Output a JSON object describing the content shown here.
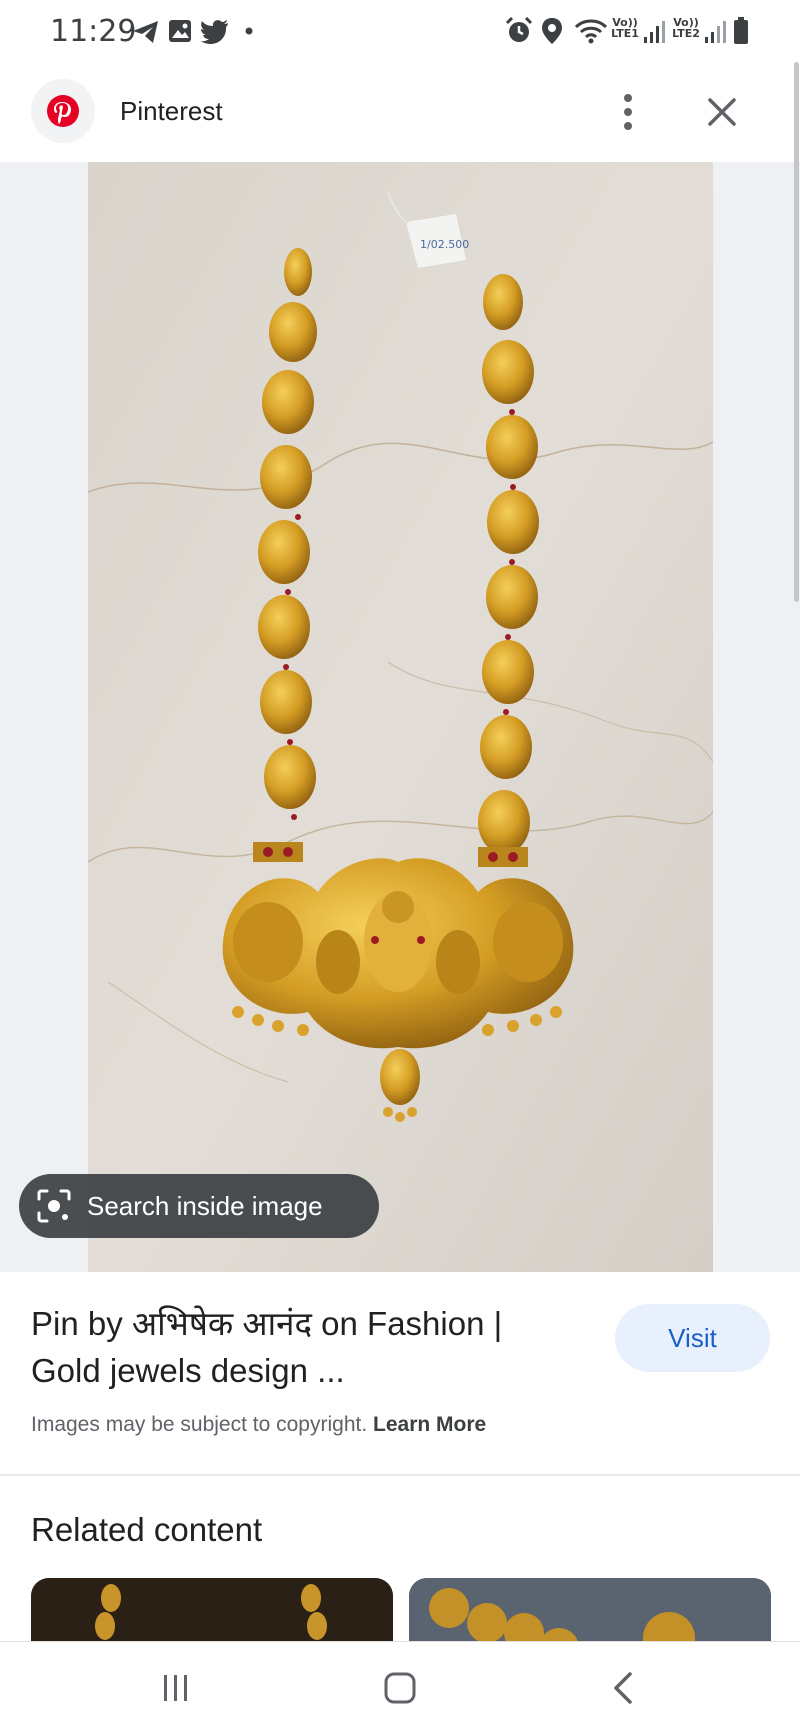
{
  "status_bar": {
    "time": "11:29",
    "left_icons": [
      "telegram-icon",
      "gallery-icon",
      "twitter-icon",
      "dot-icon"
    ],
    "right_icons": [
      "alarm-icon",
      "location-icon",
      "wifi-icon",
      "signal-icon",
      "battery-icon"
    ],
    "sim1_volte": "Vo))",
    "sim1_label": "LTE1",
    "sim2_volte": "Vo))",
    "sim2_label": "LTE2"
  },
  "header": {
    "site_name": "Pinterest",
    "logo_icon": "pinterest-logo",
    "more_icon": "more-vertical-icon",
    "close_icon": "close-icon",
    "brand_color": "#e60023"
  },
  "image": {
    "lens_button_label": "Search inside image",
    "tag_text": "1/02.500",
    "colors": {
      "gold": "#c9961e",
      "marble": "#d8d3cc",
      "backdrop": "#eef0f3"
    }
  },
  "result": {
    "title_line1": "Pin by अभिषेक आनंद on Fashion |",
    "title_line2": "Gold jewels design ...",
    "visit_label": "Visit",
    "copyright_text": "Images may be subject to copyright.",
    "learn_more_label": "Learn More"
  },
  "related": {
    "heading": "Related content"
  },
  "nav_bar": {
    "icons": [
      "recent-apps-icon",
      "home-icon",
      "back-icon"
    ]
  }
}
